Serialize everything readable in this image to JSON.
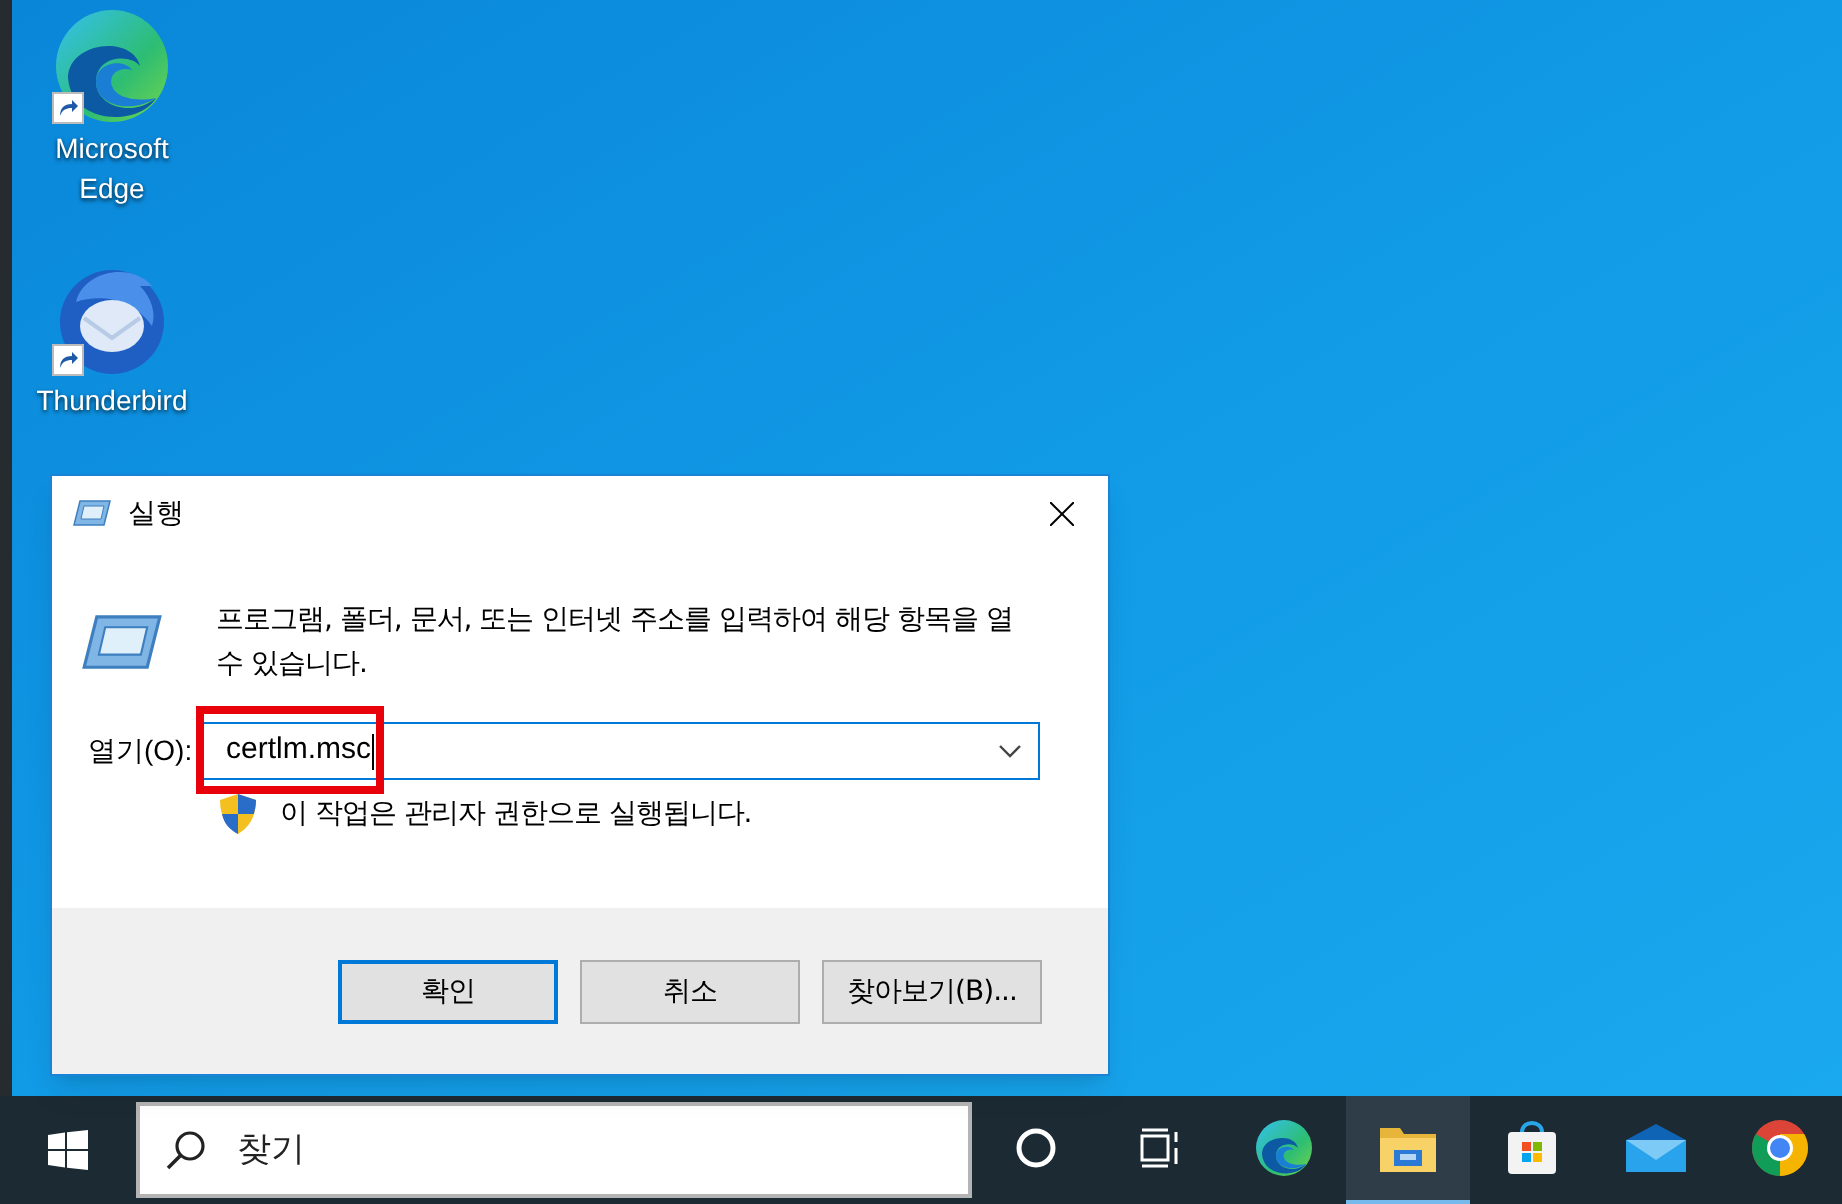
{
  "desktop_icons": [
    {
      "kind": "edge",
      "label": "Microsoft Edge"
    },
    {
      "kind": "thunderbird",
      "label": "Thunderbird"
    }
  ],
  "dialog": {
    "title": "실행",
    "description": "프로그램, 폴더, 문서, 또는 인터넷 주소를 입력하여 해당 항목을 열 수 있습니다.",
    "open_label": "열기(O):",
    "open_value": "certlm.msc",
    "admin_note": "이 작업은 관리자 권한으로 실행됩니다.",
    "highlighted": true,
    "buttons": [
      {
        "label": "확인",
        "default": true
      },
      {
        "label": "취소",
        "default": false
      },
      {
        "label": "찾아보기(B)...",
        "default": false
      }
    ]
  },
  "taskbar": {
    "search": {
      "placeholder": "찾기"
    },
    "apps": [
      {
        "kind": "cortana",
        "selected": false
      },
      {
        "kind": "taskview",
        "selected": false
      },
      {
        "kind": "edge",
        "selected": false
      },
      {
        "kind": "explorer",
        "selected": true
      },
      {
        "kind": "store",
        "selected": false
      },
      {
        "kind": "mail",
        "selected": false
      },
      {
        "kind": "chrome",
        "selected": false
      }
    ]
  }
}
